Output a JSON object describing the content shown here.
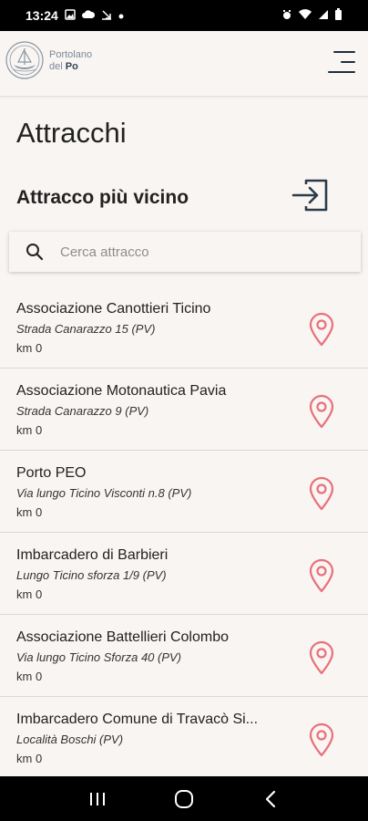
{
  "status": {
    "time": "13:24",
    "left_icons": [
      "photo-icon",
      "cloud-icon",
      "download-icon",
      "dot-icon"
    ],
    "right_icons": [
      "alarm-icon",
      "wifi-icon",
      "signal-icon",
      "battery-icon"
    ]
  },
  "header": {
    "logo_line1": "Portolano",
    "logo_line2_a": "del ",
    "logo_line2_b": "Po",
    "menu_icon": "hamburger-menu-icon"
  },
  "page": {
    "title": "Attracchi",
    "nearest_label": "Attracco più vicino",
    "nearest_icon": "login-arrow-icon"
  },
  "search": {
    "placeholder": "Cerca attracco",
    "value": ""
  },
  "moorings": [
    {
      "name": "Associazione Canottieri Ticino",
      "address": "Strada Canarazzo 15 (PV)",
      "distance": "km 0"
    },
    {
      "name": "Associazione Motonautica Pavia",
      "address": "Strada Canarazzo 9 (PV)",
      "distance": "km 0"
    },
    {
      "name": "Porto PEO",
      "address": "Via lungo Ticino Visconti n.8 (PV)",
      "distance": "km 0"
    },
    {
      "name": "Imbarcadero di Barbieri",
      "address": "Lungo Ticino sforza 1/9 (PV)",
      "distance": "km 0"
    },
    {
      "name": "Associazione Battellieri Colombo",
      "address": "Via lungo Ticino Sforza 40 (PV)",
      "distance": "km 0"
    },
    {
      "name": "Imbarcadero Comune di Travacò Si...",
      "address": "Località Boschi (PV)",
      "distance": "km 0"
    }
  ],
  "colors": {
    "background": "#f9f5f2",
    "pin": "#e8707a",
    "text": "#222222",
    "navy": "#1f2d3a"
  },
  "nav": [
    "recent-apps-icon",
    "home-icon",
    "back-icon"
  ]
}
